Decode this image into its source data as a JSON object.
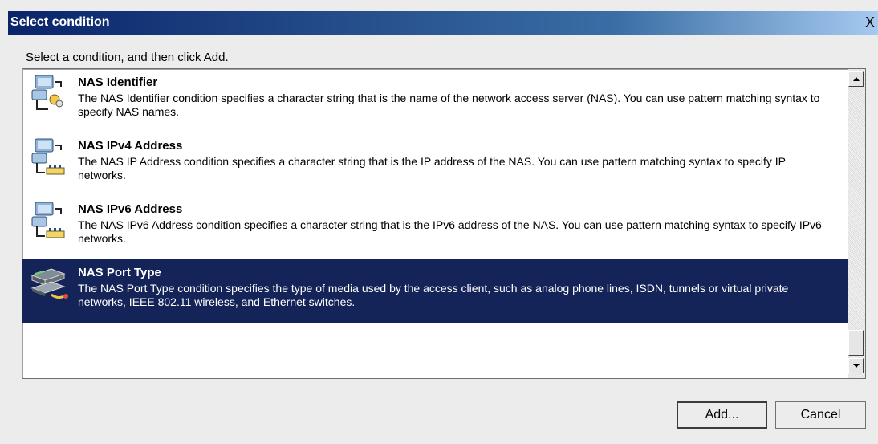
{
  "dialog": {
    "title": "Select condition",
    "close_label": "X",
    "prompt": "Select a condition, and then click Add."
  },
  "conditions": [
    {
      "name": "NAS Identifier",
      "description": "The NAS Identifier condition specifies a character string that is the name of the network access server (NAS). You can use pattern matching syntax to specify NAS names.",
      "icon": "network-computer-icon",
      "selected": false
    },
    {
      "name": "NAS IPv4 Address",
      "description": "The NAS IP Address condition specifies a character string that is the IP address of the NAS. You can use pattern matching syntax to specify IP networks.",
      "icon": "network-address-icon",
      "selected": false
    },
    {
      "name": "NAS IPv6 Address",
      "description": "The NAS IPv6 Address condition specifies a character string that is the IPv6 address of the NAS. You can use pattern matching syntax to specify IPv6 networks.",
      "icon": "network-address-icon",
      "selected": false
    },
    {
      "name": "NAS Port Type",
      "description": "The NAS Port Type condition specifies the type of media used by the access client, such as analog phone lines, ISDN, tunnels or virtual private networks, IEEE 802.11 wireless, and Ethernet switches.",
      "icon": "port-type-icon",
      "selected": true
    }
  ],
  "buttons": {
    "add": "Add...",
    "cancel": "Cancel"
  },
  "colors": {
    "selection": "#152458",
    "title_bar": "#0a246a"
  }
}
